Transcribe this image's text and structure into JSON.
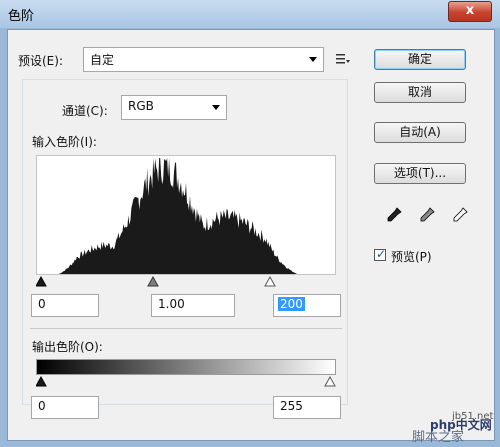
{
  "window": {
    "title": "色阶",
    "close_label": "x"
  },
  "preset": {
    "label": "预设(E):",
    "value": "自定"
  },
  "channel": {
    "label": "通道(C):",
    "value": "RGB"
  },
  "input_levels": {
    "label": "输入色阶(I):",
    "shadow": "0",
    "midtone": "1.00",
    "highlight": "200"
  },
  "output_levels": {
    "label": "输出色阶(O):",
    "shadow": "0",
    "highlight": "255"
  },
  "buttons": {
    "ok": "确定",
    "cancel": "取消",
    "auto": "自动(A)",
    "options": "选项(T)..."
  },
  "preview": {
    "label": "预览(P)",
    "checked": true
  },
  "watermark": {
    "site": "jb51.net",
    "brand": "脚本之家",
    "brand2": "php中文网"
  }
}
